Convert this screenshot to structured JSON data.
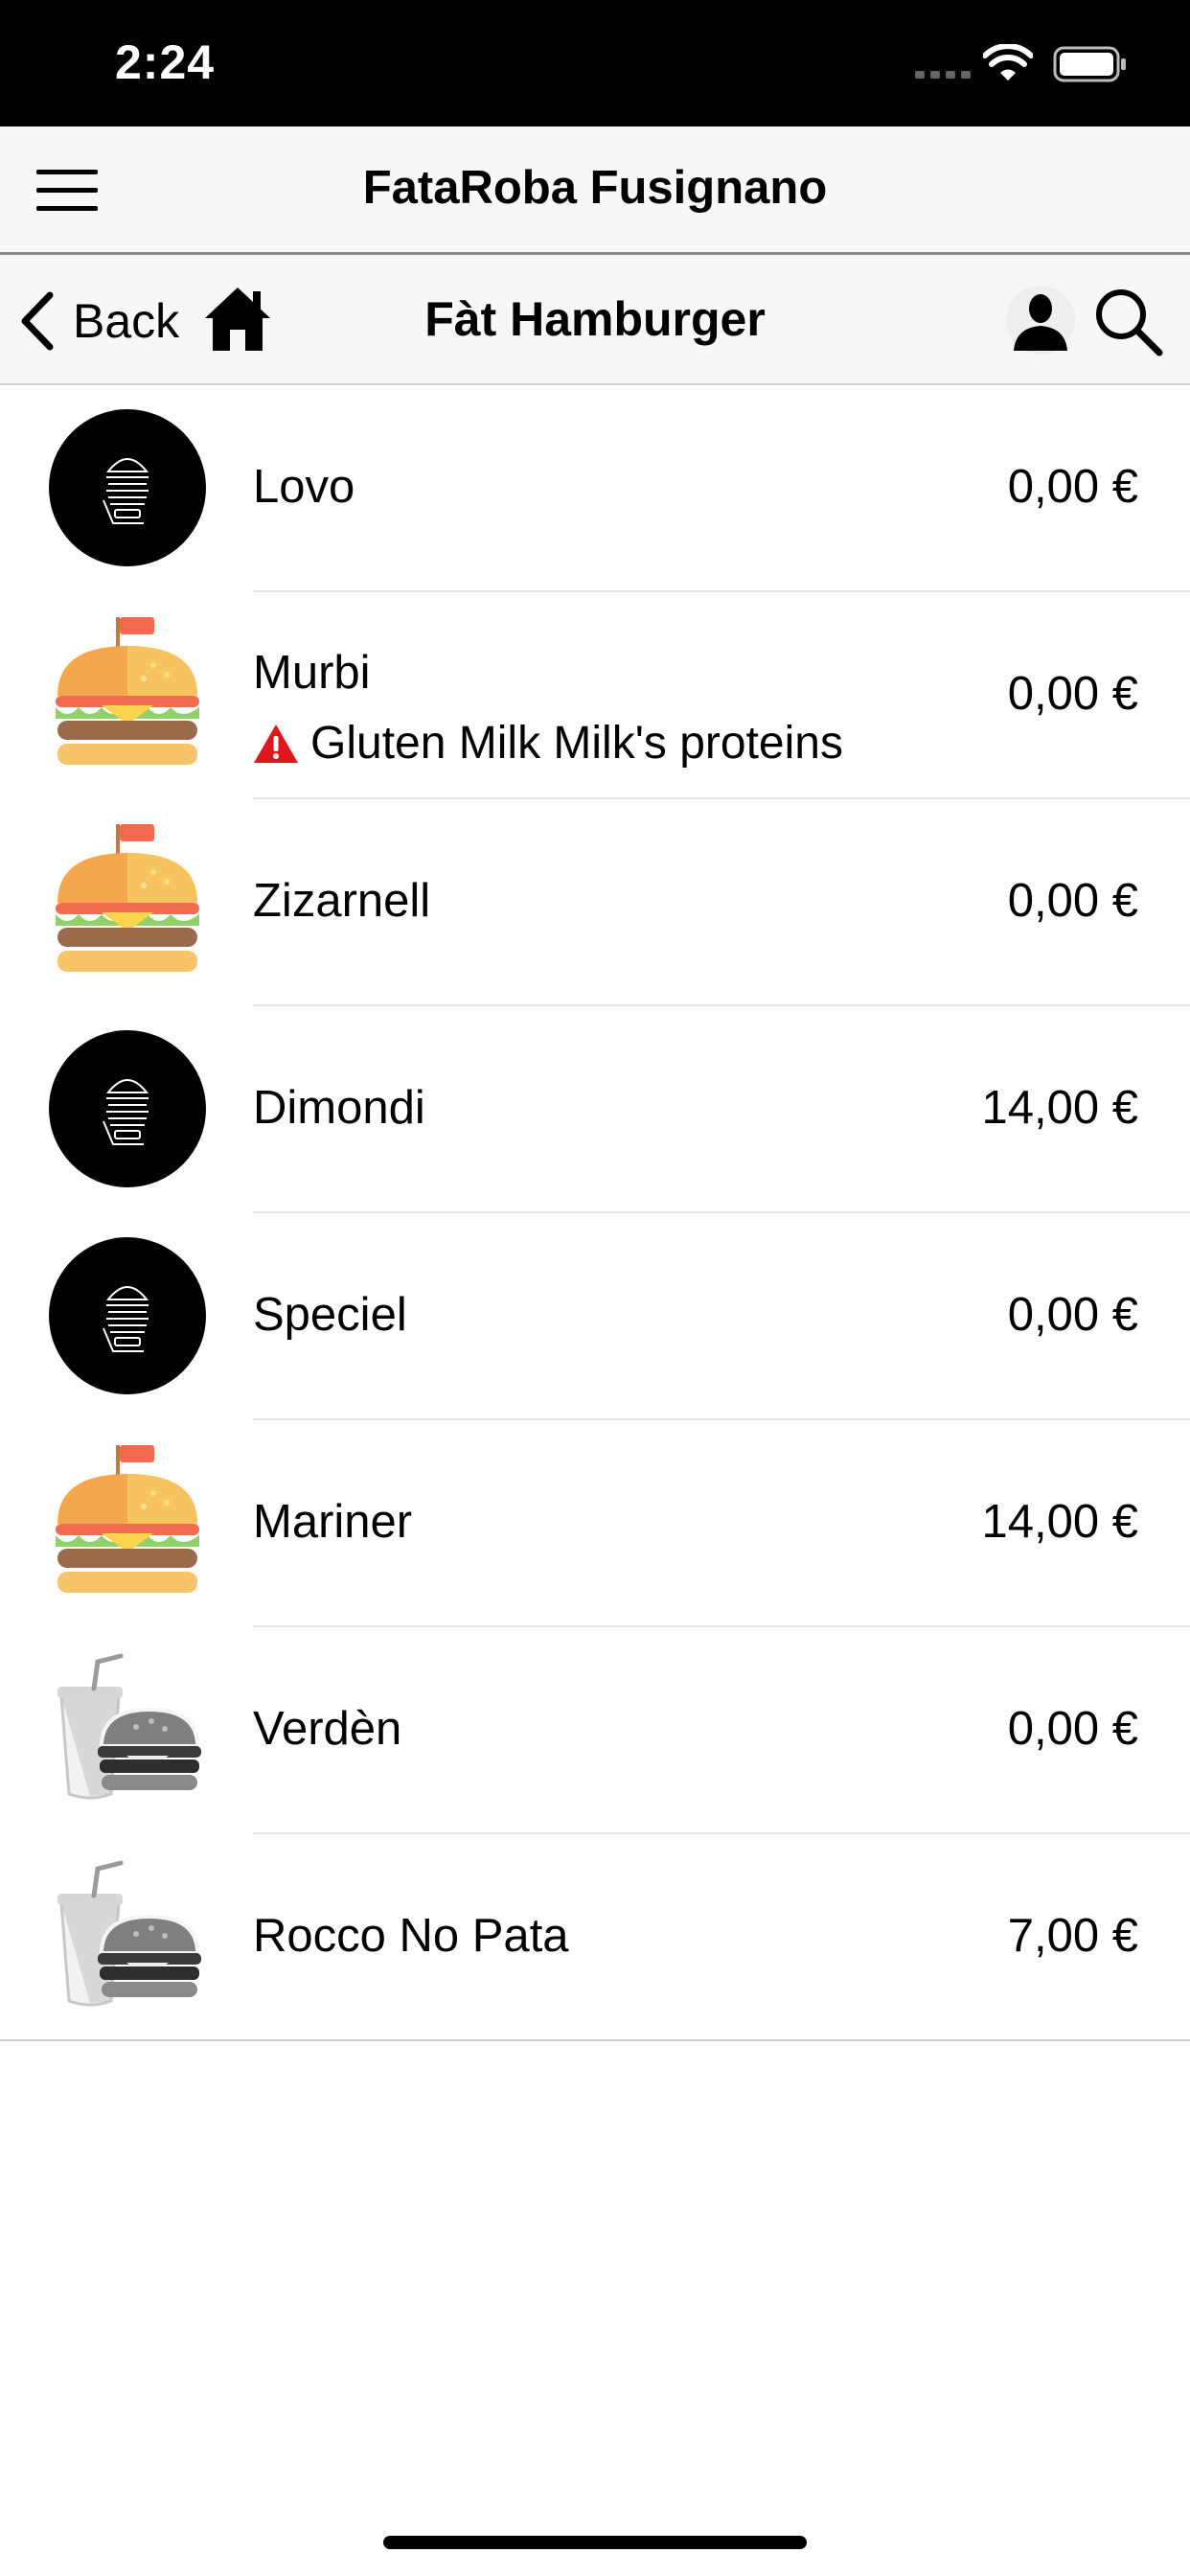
{
  "status_bar": {
    "time": "2:24"
  },
  "app_bar": {
    "title": "FataRoba Fusignano"
  },
  "nav_bar": {
    "back_label": "Back",
    "title": "Fàt Hamburger"
  },
  "items": [
    {
      "name": "Lovo",
      "price": "0,00 €",
      "icon": "black-burger-logo-icon"
    },
    {
      "name": "Murbi",
      "allergens": "Gluten Milk Milk's proteins",
      "price": "0,00 €",
      "icon": "burger-flag-icon"
    },
    {
      "name": "Zizarnell",
      "price": "0,00 €",
      "icon": "burger-flag-icon"
    },
    {
      "name": "Dimondi",
      "price": "14,00 €",
      "icon": "black-burger-logo-icon"
    },
    {
      "name": "Speciel",
      "price": "0,00 €",
      "icon": "black-burger-logo-icon"
    },
    {
      "name": "Mariner",
      "price": "14,00 €",
      "icon": "burger-flag-icon"
    },
    {
      "name": "Verdèn",
      "price": "0,00 €",
      "icon": "gray-combo-meal-icon"
    },
    {
      "name": "Rocco No Pata",
      "price": "7,00 €",
      "icon": "gray-combo-meal-icon"
    }
  ],
  "colors": {
    "header_bg": "#f7f7f7",
    "status_bg": "#000000",
    "warning_red": "#e0161b",
    "burger_bun": "#f5a74d",
    "lettuce": "#8ed36a"
  }
}
